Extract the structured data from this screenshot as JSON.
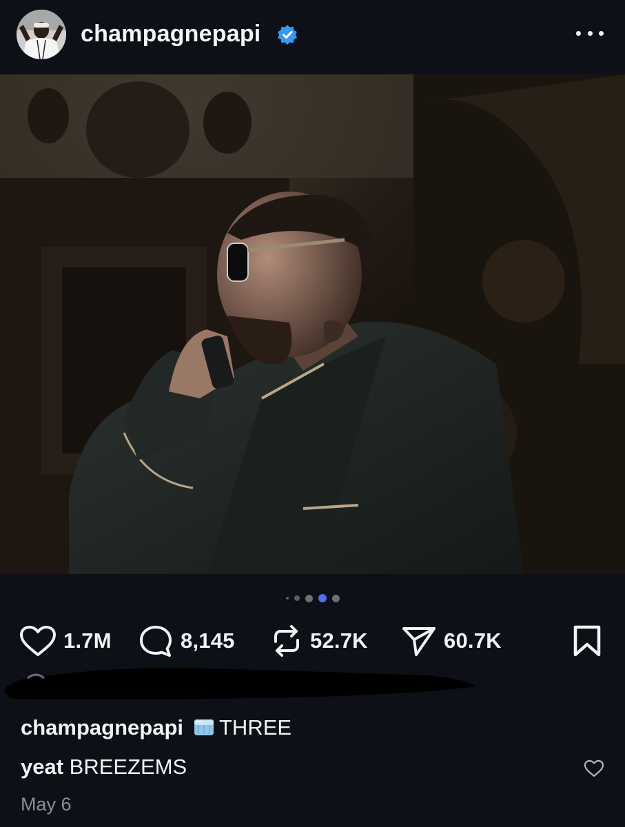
{
  "header": {
    "username": "champagnepapi",
    "verified": true,
    "more_icon": "more-horizontal-icon"
  },
  "post": {
    "image_description_icon": "post-photo",
    "carousel": {
      "total": 5,
      "active_index": 3
    }
  },
  "actions": {
    "likes": "1.7M",
    "comments": "8,145",
    "reposts": "52.7K",
    "shares": "60.7K"
  },
  "caption": {
    "username": "champagnepapi",
    "emoji": "ice-cube-icon",
    "text": "THREE"
  },
  "comment": {
    "username": "yeat",
    "text": "BREEZEMS"
  },
  "date": "May 6",
  "colors": {
    "background": "#0d1016",
    "text": "#f2f3f5",
    "verified": "#3897f0",
    "active_dot": "#4a72f0",
    "muted": "#8b8f97"
  }
}
